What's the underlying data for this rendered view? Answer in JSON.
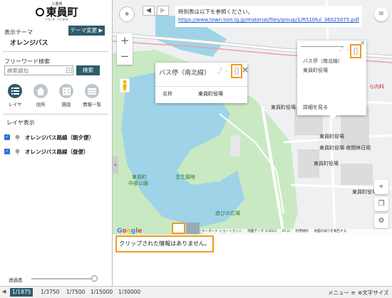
{
  "logo": {
    "top": "三重県",
    "name": "東員町",
    "sub": "TOIN TOWN"
  },
  "sidebar": {
    "theme_label": "表示テーマ",
    "theme_value": "オレンジバス",
    "theme_change_button": "テーマ変更 ▶",
    "freeword_label": "フリーワード検索",
    "search_placeholder": "検索語句",
    "search_button": "検索",
    "tools": [
      {
        "label": "レイヤ",
        "icon": "layer-list-icon"
      },
      {
        "label": "住所",
        "icon": "house-icon"
      },
      {
        "label": "施設",
        "icon": "building-icon"
      },
      {
        "label": "情報一覧",
        "icon": "list-icon"
      }
    ],
    "layer_section_title": "レイヤ表示",
    "layers": [
      {
        "name": "オレンジバス路線（朝夕便）",
        "checked": true
      },
      {
        "name": "オレンジバス路線（昼便）",
        "checked": true
      }
    ],
    "opacity_label": "透過度",
    "opacity_value": 1.0
  },
  "map": {
    "notice_line1": "時刻表は以下を参照ください。",
    "notice_url": "https://www.town.toin.lg.jp/material/files/group/1/R510ful_36025075.pdf",
    "labels": {
      "office_1": "東員町役場",
      "office_2": "東員町役場",
      "office_3": "東員町役場 夜間休日用",
      "office_4": "東員町役場",
      "park_name_1": "東員町",
      "park_name_2": "中部公園",
      "lawn": "芝生園地",
      "plaza": "遊びの広場",
      "clinic": "ら内科"
    },
    "bus_popup": {
      "title": "バス停（南北線）",
      "key": "名称",
      "value": "東員町役場"
    },
    "right_popup": {
      "close": "×",
      "line1": "バス停（南北線）",
      "line2": "東員町役場",
      "detail_link": "詳細を見る"
    },
    "attribution": {
      "shortcuts": "キーボード ショートカット",
      "map_data": "地図データ ©2023",
      "scale": "20 m",
      "terms": "利用規約",
      "report": "地図の誤りを報告する"
    },
    "google": "Google"
  },
  "info": {
    "clip_message": "クリップされた情報はありません。"
  },
  "bottombar": {
    "scales": [
      "1/1875",
      "1/3750",
      "1/7500",
      "1/15000",
      "1/30000"
    ],
    "selected_scale": "1/1875",
    "menu": "メニュー",
    "font_size": "文字サイズ"
  },
  "colors": {
    "accent": "#2d5c6a",
    "highlight": "#f29a1a",
    "checkbox": "#2f6fd6",
    "water": "#9fd3e8",
    "park": "#c9e9c3"
  }
}
